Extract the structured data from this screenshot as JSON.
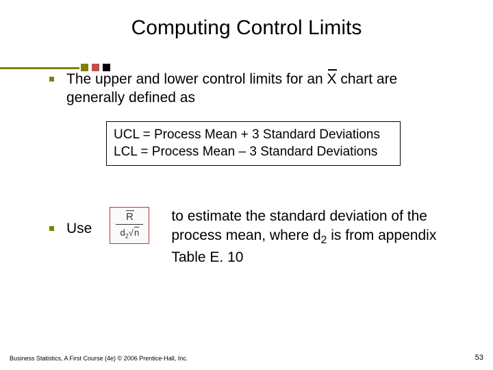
{
  "title": "Computing Control Limits",
  "bullet1_prefix": "The upper and lower control limits for an ",
  "bullet1_x": "X",
  "bullet1_suffix": " chart are generally defined as",
  "box_line1": "UCL = Process Mean + 3 Standard Deviations",
  "box_line2": "LCL = Process Mean – 3 Standard Deviations",
  "use_label": "Use",
  "formula": {
    "numerator": "R",
    "denom_d": "d",
    "denom_sub": "2",
    "denom_root": "√",
    "denom_n": "n"
  },
  "explain_prefix": "to estimate the standard deviation of the process mean, where d",
  "explain_sub": "2",
  "explain_suffix": " is from appendix Table E. 10",
  "footer": "Business Statistics, A First Course (4e) © 2006 Prentice-Hall, Inc.",
  "page": "53"
}
